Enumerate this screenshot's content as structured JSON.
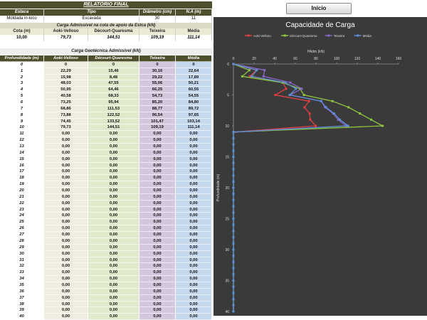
{
  "report": {
    "title": "RELATÓRIO FINAL",
    "header_labels": {
      "estaca": "Estaca",
      "tipo": "Tipo",
      "diametro": "Diâmetro (cm)",
      "na": "N.A (m)"
    },
    "values": {
      "estaca": "Moldada in-loco",
      "tipo": "Escavada",
      "diametro": "30",
      "na": "11"
    },
    "band1": "Carga Admissível na cota de apoio da Estca (kN)",
    "cota_labels": {
      "cota": "Cota (m)",
      "aoki": "Aoki-Velloso",
      "decourt": "Décourt-Quaresma",
      "teixeira": "Teixeira",
      "media": "Média"
    },
    "cota_values": {
      "cota": "10,00",
      "aoki": "79,73",
      "decourt": "144,51",
      "teixeira": "109,19",
      "media": "111,14"
    },
    "band2": "Carga Geotécnica Admissível (kN)",
    "table_headers": {
      "prof": "Profundidade (m)",
      "aoki": "Aoki-Velloso",
      "decourt": "Décourt-Quaresma",
      "teixeira": "Teixeira",
      "media": "Média"
    },
    "rows": [
      [
        "0",
        "0",
        "0",
        "0",
        "0"
      ],
      [
        "1",
        "22,29",
        "15,46",
        "30,16",
        "22,64"
      ],
      [
        "2",
        "15,98",
        "8,48",
        "29,22",
        "17,89"
      ],
      [
        "3",
        "48,03",
        "47,55",
        "55,06",
        "50,21"
      ],
      [
        "4",
        "50,95",
        "64,46",
        "66,25",
        "60,55"
      ],
      [
        "5",
        "40,58",
        "68,33",
        "54,73",
        "54,55"
      ],
      [
        "6",
        "73,25",
        "95,94",
        "85,20",
        "84,80"
      ],
      [
        "7",
        "68,86",
        "111,53",
        "88,77",
        "89,72"
      ],
      [
        "8",
        "73,88",
        "122,52",
        "96,54",
        "97,65"
      ],
      [
        "9",
        "74,45",
        "133,52",
        "101,47",
        "103,14"
      ],
      [
        "10",
        "79,73",
        "144,51",
        "109,19",
        "111,14"
      ],
      [
        "11",
        "0,00",
        "0,00",
        "0,00",
        "0,00"
      ],
      [
        "12",
        "0,00",
        "0,00",
        "0,00",
        "0,00"
      ],
      [
        "13",
        "0,00",
        "0,00",
        "0,00",
        "0,00"
      ],
      [
        "14",
        "0,00",
        "0,00",
        "0,00",
        "0,00"
      ],
      [
        "15",
        "0,00",
        "0,00",
        "0,00",
        "0,00"
      ],
      [
        "16",
        "0,00",
        "0,00",
        "0,00",
        "0,00"
      ],
      [
        "17",
        "0,00",
        "0,00",
        "0,00",
        "0,00"
      ],
      [
        "18",
        "0,00",
        "0,00",
        "0,00",
        "0,00"
      ],
      [
        "19",
        "0,00",
        "0,00",
        "0,00",
        "0,00"
      ],
      [
        "20",
        "0,00",
        "0,00",
        "0,00",
        "0,00"
      ],
      [
        "21",
        "0,00",
        "0,00",
        "0,00",
        "0,00"
      ],
      [
        "22",
        "0,00",
        "0,00",
        "0,00",
        "0,00"
      ],
      [
        "23",
        "0,00",
        "0,00",
        "0,00",
        "0,00"
      ],
      [
        "24",
        "0,00",
        "0,00",
        "0,00",
        "0,00"
      ],
      [
        "25",
        "0,00",
        "0,00",
        "0,00",
        "0,00"
      ],
      [
        "26",
        "0,00",
        "0,00",
        "0,00",
        "0,00"
      ],
      [
        "27",
        "0,00",
        "0,00",
        "0,00",
        "0,00"
      ],
      [
        "28",
        "0,00",
        "0,00",
        "0,00",
        "0,00"
      ],
      [
        "29",
        "0,00",
        "0,00",
        "0,00",
        "0,00"
      ],
      [
        "30",
        "0,00",
        "0,00",
        "0,00",
        "0,00"
      ],
      [
        "31",
        "0,00",
        "0,00",
        "0,00",
        "0,00"
      ],
      [
        "32",
        "0,00",
        "0,00",
        "0,00",
        "0,00"
      ],
      [
        "33",
        "0,00",
        "0,00",
        "0,00",
        "0,00"
      ],
      [
        "34",
        "0,00",
        "0,00",
        "0,00",
        "0,00"
      ],
      [
        "35",
        "0,00",
        "0,00",
        "0,00",
        "0,00"
      ],
      [
        "36",
        "0,00",
        "0,00",
        "0,00",
        "0,00"
      ],
      [
        "37",
        "0,00",
        "0,00",
        "0,00",
        "0,00"
      ],
      [
        "38",
        "0,00",
        "0,00",
        "0,00",
        "0,00"
      ],
      [
        "39",
        "0,00",
        "0,00",
        "0,00",
        "0,00"
      ],
      [
        "40",
        "0,00",
        "0,00",
        "0,00",
        "0,00"
      ]
    ]
  },
  "button": {
    "label": "Início"
  },
  "chart_data": {
    "type": "line",
    "title": "Capacidade de Carga",
    "xlabel": "PAdm (kN)",
    "ylabel": "Profundidade (m)",
    "xlim": [
      0,
      160
    ],
    "ylim": [
      0,
      40
    ],
    "x_ticks": [
      "0",
      "20",
      "40",
      "60",
      "80",
      "100",
      "120",
      "140",
      "160"
    ],
    "y_ticks": [
      "0",
      "5",
      "10",
      "15",
      "20",
      "25",
      "30",
      "35",
      "40"
    ],
    "legend_position": "top",
    "background": "#3a3a3a",
    "series": [
      {
        "name": "Aoki-Velloso",
        "color": "#e0403f",
        "x": [
          0,
          22.29,
          15.98,
          48.03,
          50.95,
          40.58,
          73.25,
          68.86,
          73.88,
          74.45,
          79.73,
          0,
          0,
          0,
          0,
          0,
          0,
          0,
          0,
          0,
          0,
          0,
          0,
          0,
          0,
          0,
          0,
          0,
          0,
          0,
          0,
          0,
          0,
          0,
          0,
          0,
          0,
          0,
          0,
          0,
          0
        ]
      },
      {
        "name": "Décourt-Quaresma",
        "color": "#8dc63f",
        "x": [
          0,
          15.46,
          8.48,
          47.55,
          64.46,
          68.33,
          95.94,
          111.53,
          122.52,
          133.52,
          144.51,
          0,
          0,
          0,
          0,
          0,
          0,
          0,
          0,
          0,
          0,
          0,
          0,
          0,
          0,
          0,
          0,
          0,
          0,
          0,
          0,
          0,
          0,
          0,
          0,
          0,
          0,
          0,
          0,
          0,
          0
        ]
      },
      {
        "name": "Teixeira",
        "color": "#8a66c8",
        "x": [
          0,
          30.16,
          29.22,
          55.06,
          66.25,
          54.73,
          85.2,
          88.77,
          96.54,
          101.47,
          109.19,
          0,
          0,
          0,
          0,
          0,
          0,
          0,
          0,
          0,
          0,
          0,
          0,
          0,
          0,
          0,
          0,
          0,
          0,
          0,
          0,
          0,
          0,
          0,
          0,
          0,
          0,
          0,
          0,
          0,
          0
        ]
      },
      {
        "name": "Média",
        "color": "#5b8fd6",
        "x": [
          0,
          22.64,
          17.89,
          50.21,
          60.55,
          54.55,
          84.8,
          89.72,
          97.65,
          103.14,
          111.14,
          0,
          0,
          0,
          0,
          0,
          0,
          0,
          0,
          0,
          0,
          0,
          0,
          0,
          0,
          0,
          0,
          0,
          0,
          0,
          0,
          0,
          0,
          0,
          0,
          0,
          0,
          0,
          0,
          0,
          0
        ]
      }
    ],
    "y": [
      0,
      1,
      2,
      3,
      4,
      5,
      6,
      7,
      8,
      9,
      10,
      11,
      12,
      13,
      14,
      15,
      16,
      17,
      18,
      19,
      20,
      21,
      22,
      23,
      24,
      25,
      26,
      27,
      28,
      29,
      30,
      31,
      32,
      33,
      34,
      35,
      36,
      37,
      38,
      39,
      40
    ]
  }
}
